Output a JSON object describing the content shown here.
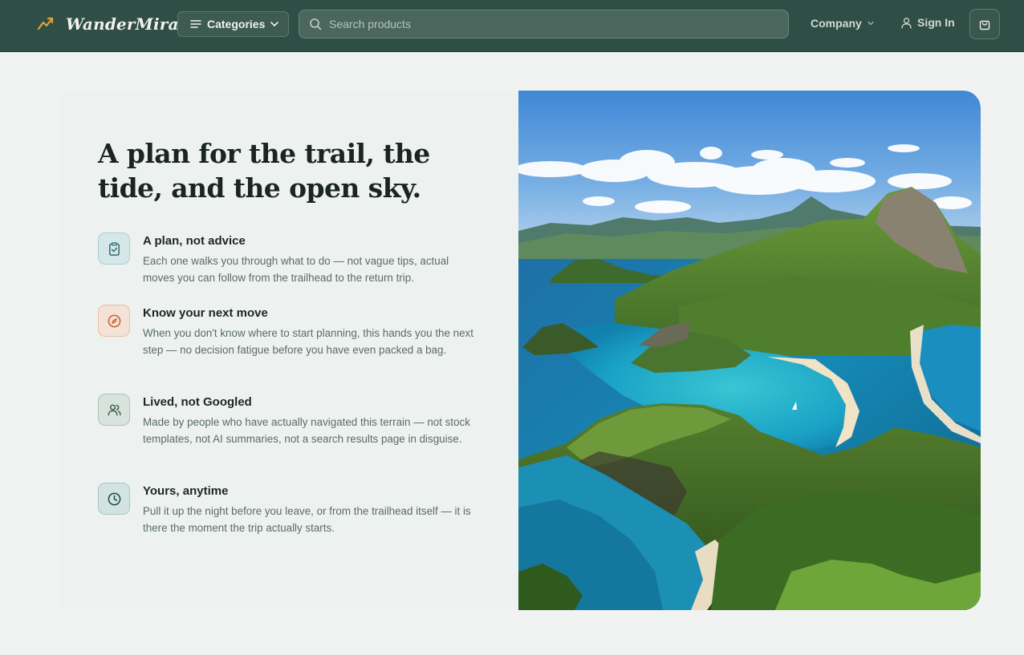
{
  "header": {
    "brand_name": "WanderMira",
    "brand_icon": "trend-line-icon",
    "categories_label": "Categories",
    "search_placeholder": "Search products",
    "company_label": "Company",
    "signin_label": "Sign In",
    "accent_color": "#e0a43a",
    "header_bg": "#2f4e45"
  },
  "hero": {
    "headline": "A plan for the trail, the tide, and the open sky.",
    "features": [
      {
        "icon": "clipboard-check-icon",
        "title": "A plan, not advice",
        "description": "Each one walks you through what to do — not vague tips, actual moves you can follow from the trailhead to the return trip."
      },
      {
        "icon": "compass-icon",
        "title": "Know your next move",
        "description": "When you don't know where to start planning, this hands you the next step — no decision fatigue before you have even packed a bag."
      },
      {
        "icon": "users-icon",
        "title": "Lived, not Googled",
        "description": "Made by people who have actually navigated this terrain — not stock templates, not AI summaries, not a search results page in disguise."
      },
      {
        "icon": "clock-icon",
        "title": "Yours, anytime",
        "description": "Pull it up the night before you leave, or from the trailhead itself — it is there the moment the trip actually starts."
      }
    ],
    "image_subject": "island-coastline-landscape"
  }
}
